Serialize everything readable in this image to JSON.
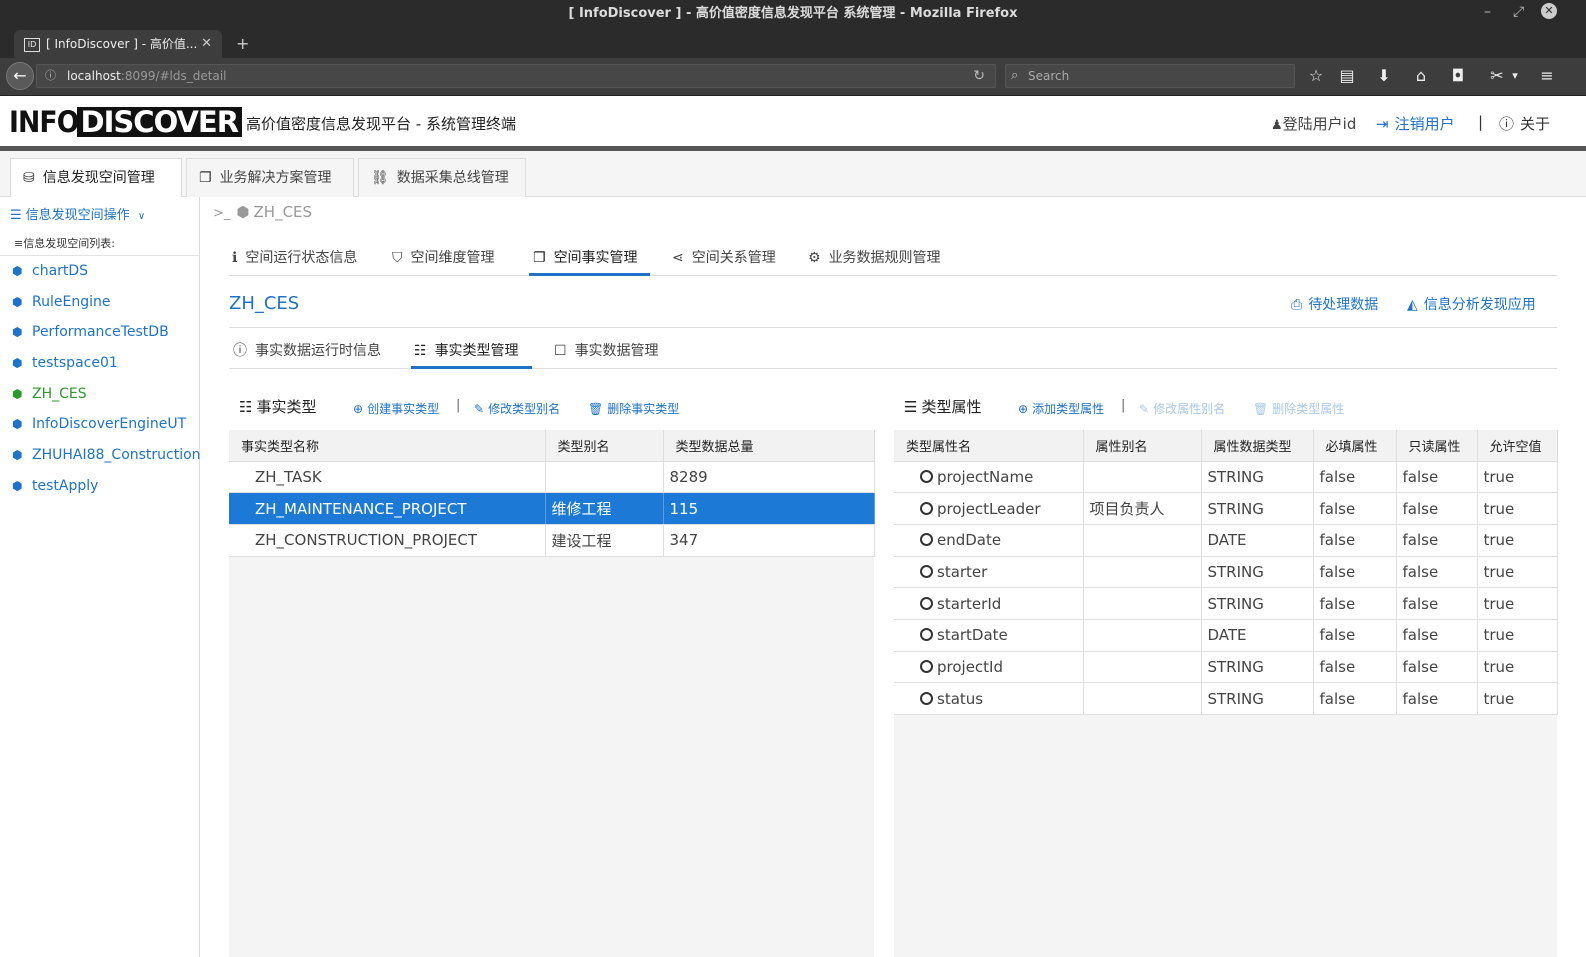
{
  "browser": {
    "window_title": "[ InfoDiscover ] - 高价值密度信息发现平台 系统管理 - Mozilla Firefox",
    "tab_title": "[ InfoDiscover ] - 高价值...",
    "url_host": "localhost",
    "url_rest": ":8099/#lds_detail",
    "search_placeholder": "Search"
  },
  "header": {
    "logo_info": "INFO",
    "logo_discover": "DISCOVER",
    "subtitle": "高价值密度信息发现平台 - 系统管理终端",
    "login_user": "登陆用户id",
    "logout": "注销用户",
    "divider": "|",
    "about": "关于"
  },
  "main_tabs": [
    {
      "label": "信息发现空间管理",
      "active": true
    },
    {
      "label": "业务解决方案管理",
      "active": false
    },
    {
      "label": "数据采集总线管理",
      "active": false
    }
  ],
  "sidebar": {
    "ops_label": "信息发现空间操作",
    "list_label": "信息发现空间列表:",
    "items": [
      {
        "label": "chartDS",
        "current": false
      },
      {
        "label": "RuleEngine",
        "current": false
      },
      {
        "label": "PerformanceTestDB",
        "current": false
      },
      {
        "label": "testspace01",
        "current": false
      },
      {
        "label": "ZH_CES",
        "current": true
      },
      {
        "label": "InfoDiscoverEngineUT",
        "current": false
      },
      {
        "label": "ZHUHAI88_Construction",
        "current": false
      },
      {
        "label": "testApply",
        "current": false
      }
    ]
  },
  "breadcrumb": {
    "prompt": ">_",
    "space": "ZH_CES"
  },
  "space_tabs": [
    {
      "label": "空间运行状态信息"
    },
    {
      "label": "空间维度管理"
    },
    {
      "label": "空间事实管理",
      "active": true
    },
    {
      "label": "空间关系管理"
    },
    {
      "label": "业务数据规则管理"
    }
  ],
  "space_title": "ZH_CES",
  "right_links": {
    "pending": "待处理数据",
    "analysis": "信息分析发现应用"
  },
  "fact_tabs": [
    {
      "label": "事实数据运行时信息"
    },
    {
      "label": "事实类型管理",
      "active": true
    },
    {
      "label": "事实数据管理"
    }
  ],
  "fact_types": {
    "title": "事实类型",
    "actions": {
      "create": "创建事实类型",
      "rename": "修改类型别名",
      "delete": "删除事实类型"
    },
    "columns": [
      "事实类型名称",
      "类型别名",
      "类型数据总量"
    ],
    "rows": [
      {
        "name": "ZH_TASK",
        "alias": "",
        "count": "8289",
        "selected": false
      },
      {
        "name": "ZH_MAINTENANCE_PROJECT",
        "alias": "维修工程",
        "count": "115",
        "selected": true
      },
      {
        "name": "ZH_CONSTRUCTION_PROJECT",
        "alias": "建设工程",
        "count": "347",
        "selected": false
      }
    ]
  },
  "type_props": {
    "title": "类型属性",
    "actions": {
      "add": "添加类型属性",
      "rename": "修改属性别名",
      "delete": "删除类型属性"
    },
    "columns": [
      "类型属性名",
      "属性别名",
      "属性数据类型",
      "必填属性",
      "只读属性",
      "允许空值"
    ],
    "rows": [
      [
        "projectName",
        "",
        "STRING",
        "false",
        "false",
        "true"
      ],
      [
        "projectLeader",
        "项目负责人",
        "STRING",
        "false",
        "false",
        "true"
      ],
      [
        "endDate",
        "",
        "DATE",
        "false",
        "false",
        "true"
      ],
      [
        "starter",
        "",
        "STRING",
        "false",
        "false",
        "true"
      ],
      [
        "starterId",
        "",
        "STRING",
        "false",
        "false",
        "true"
      ],
      [
        "startDate",
        "",
        "DATE",
        "false",
        "false",
        "true"
      ],
      [
        "projectId",
        "",
        "STRING",
        "false",
        "false",
        "true"
      ],
      [
        "status",
        "",
        "STRING",
        "false",
        "false",
        "true"
      ]
    ]
  }
}
